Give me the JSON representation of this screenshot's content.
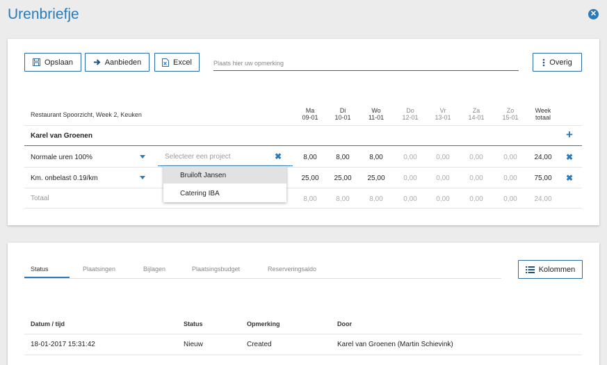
{
  "header": {
    "title": "Urenbriefje"
  },
  "toolbar": {
    "save_label": "Opslaan",
    "offer_label": "Aanbieden",
    "excel_label": "Excel",
    "other_label": "Overig",
    "remark_placeholder": "Plaats hier uw opmerking"
  },
  "timesheet": {
    "project_header": "Restaurant Spoorzicht, Week 2, Keuken",
    "days": [
      {
        "name": "Ma",
        "date": "09-01"
      },
      {
        "name": "Di",
        "date": "10-01"
      },
      {
        "name": "Wo",
        "date": "11-01"
      },
      {
        "name": "Do",
        "date": "12-01"
      },
      {
        "name": "Vr",
        "date": "13-01"
      },
      {
        "name": "Za",
        "date": "14-01"
      },
      {
        "name": "Zo",
        "date": "15-01"
      }
    ],
    "week_total_label": {
      "line1": "Week",
      "line2": "totaal"
    },
    "employee": "Karel van Groenen",
    "rows": [
      {
        "label": "Normale uren 100%",
        "project_placeholder": "Selecteer een project",
        "values": [
          "8,00",
          "8,00",
          "8,00",
          "0,00",
          "0,00",
          "0,00",
          "0,00"
        ],
        "total": "24,00"
      },
      {
        "label": "Km. onbelast 0.19/km",
        "values": [
          "25,00",
          "25,00",
          "25,00",
          "0,00",
          "0,00",
          "0,00",
          "0,00"
        ],
        "total": "75,00"
      }
    ],
    "total_row": {
      "label": "Totaal",
      "values": [
        "8,00",
        "8,00",
        "8,00",
        "0,00",
        "0,00",
        "0,00",
        "0,00"
      ],
      "total": "24,00"
    },
    "project_options": [
      "Bruiloft Jansen",
      "Catering IBA"
    ]
  },
  "details": {
    "tabs": [
      "Status",
      "Plaatsingen",
      "Bijlagen",
      "Plaatsingsbudget",
      "Reserveringsaldo"
    ],
    "columns_button": "Kolommen",
    "table_headers": [
      "Datum / tijd",
      "Status",
      "Opmerking",
      "Door"
    ],
    "rows": [
      {
        "datetime": "18-01-2017 15:31:42",
        "status": "Nieuw",
        "remark": "Created",
        "by": "Karel van Groenen (Martin Schievink)"
      }
    ]
  },
  "colors": {
    "accent": "#2a7ab8",
    "border": "#2a6aa8"
  }
}
